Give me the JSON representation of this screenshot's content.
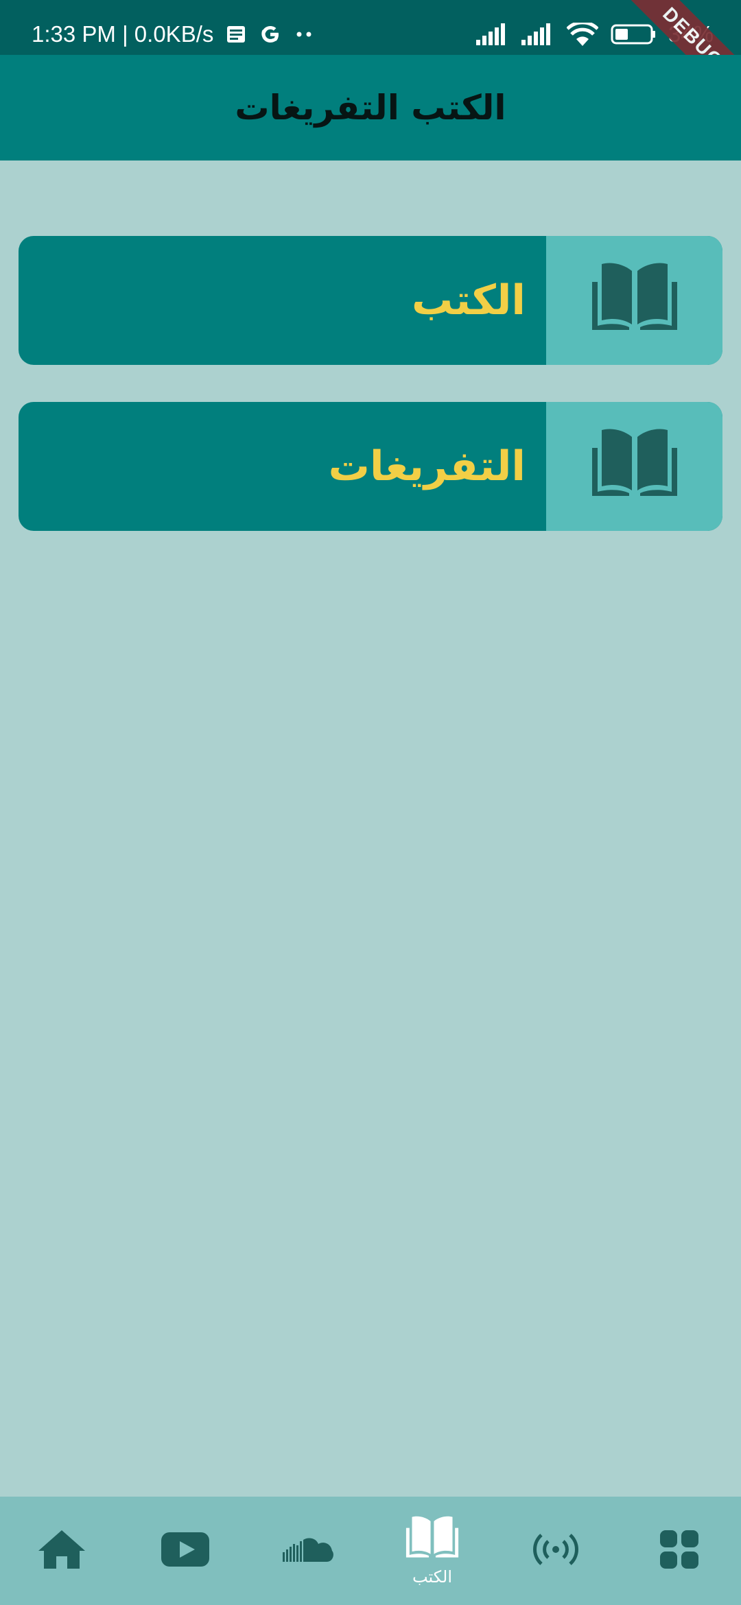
{
  "status_bar": {
    "time_speed": "1:33 PM | 0.0KB/s",
    "battery_text": "34%",
    "debug_banner": "DEBUG"
  },
  "app_bar": {
    "title": "الكتب التفريغات"
  },
  "cards": [
    {
      "label": "الكتب",
      "icon": "open-book-icon"
    },
    {
      "label": "التفريغات",
      "icon": "open-book-icon"
    }
  ],
  "bottom_nav": {
    "items": [
      {
        "icon": "home-icon",
        "label": ""
      },
      {
        "icon": "youtube-icon",
        "label": ""
      },
      {
        "icon": "soundcloud-icon",
        "label": ""
      },
      {
        "icon": "open-book-icon",
        "label": "الكتب",
        "active": true
      },
      {
        "icon": "broadcast-icon",
        "label": ""
      },
      {
        "icon": "apps-grid-icon",
        "label": ""
      }
    ]
  },
  "colors": {
    "background": "#acd1cf",
    "status_bar": "#02605f",
    "app_bar": "#017f7d",
    "card": "#017f7d",
    "card_icon_box": "#58bdba",
    "card_label": "#f2cf46",
    "icon_dark": "#1f5f5c",
    "bottom_nav": "#80bfbe"
  }
}
